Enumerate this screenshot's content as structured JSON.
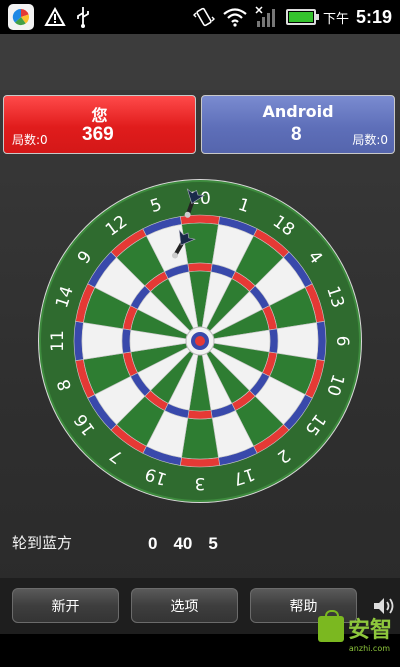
{
  "status_bar": {
    "ampm": "下午",
    "time": "5:19",
    "icons": [
      "app-icon",
      "alert-icon",
      "usb-icon",
      "vibrate-icon",
      "wifi-icon",
      "signal-icon",
      "battery-icon"
    ]
  },
  "players": {
    "red": {
      "name": "您",
      "score": "369",
      "rounds": "局数:0",
      "color": "#e02020"
    },
    "blue": {
      "name": "Android",
      "score": "8",
      "rounds": "局数:0",
      "color": "#5e6fb9"
    }
  },
  "board": {
    "numbers": [
      "20",
      "1",
      "18",
      "4",
      "13",
      "6",
      "10",
      "15",
      "2",
      "17",
      "3",
      "19",
      "7",
      "16",
      "8",
      "11",
      "14",
      "9",
      "12",
      "5"
    ],
    "colors": {
      "green": "#2e7d32",
      "white": "#f2f2f2",
      "red": "#e53935",
      "blue": "#3949ab",
      "rim": "#2f6b2f"
    },
    "darts": 2
  },
  "turn": {
    "label": "轮到蓝方"
  },
  "dart_scores": [
    "0",
    "40",
    "5"
  ],
  "buttons": {
    "new_game": "新开",
    "options": "选项",
    "help": "帮助"
  },
  "watermark": {
    "text": "安智",
    "sub": "anzhi.com"
  }
}
